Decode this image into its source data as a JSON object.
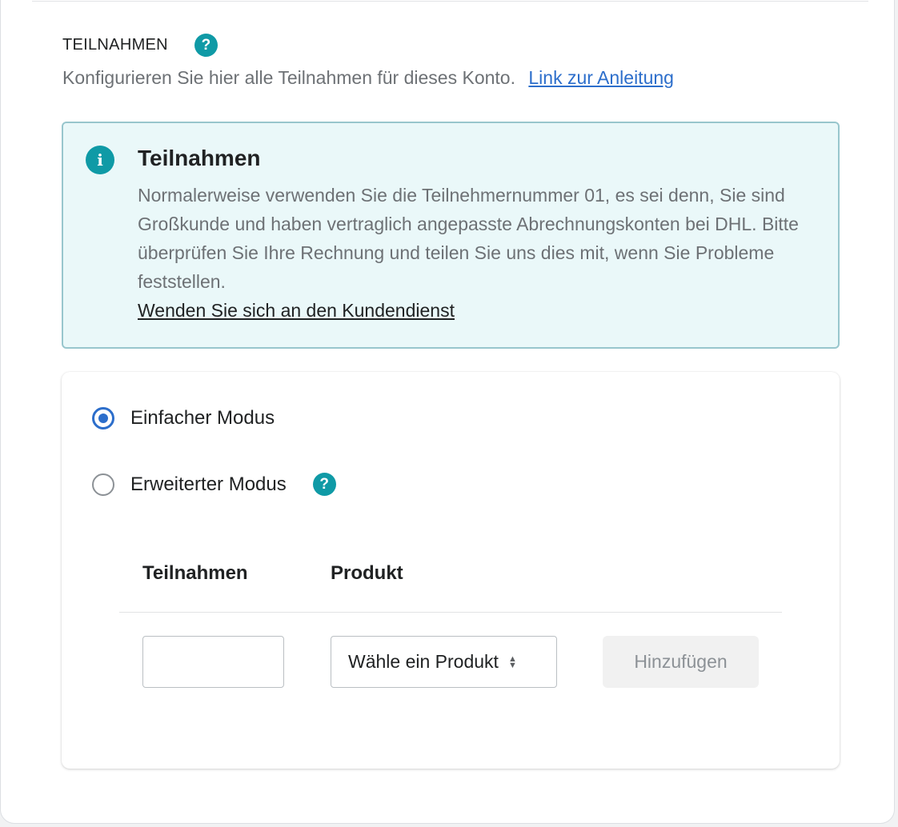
{
  "section": {
    "title": "TEILNAHMEN",
    "description": "Konfigurieren Sie hier alle Teilnahmen für dieses Konto.",
    "guide_link": "Link zur Anleitung"
  },
  "banner": {
    "title": "Teilnahmen",
    "body": "Normalerweise verwenden Sie die Teilnehmernummer 01, es sei denn, Sie sind Großkunde und haben vertraglich angepasste Abrechnungskonten bei DHL. Bitte überprüfen Sie Ihre Rechnung und teilen Sie uns dies mit, wenn Sie Probleme feststellen.",
    "support_link": "Wenden Sie sich an den Kundendienst"
  },
  "modes": {
    "simple": {
      "label": "Einfacher Modus",
      "checked": true
    },
    "advanced": {
      "label": "Erweiterter Modus",
      "checked": false
    }
  },
  "table": {
    "headers": [
      "Teilnahmen",
      "Produkt"
    ],
    "participation_value": "",
    "product_select": "Wähle ein Produkt",
    "add_button": "Hinzufügen"
  },
  "icons": {
    "help": "question-circle-icon",
    "info": "info-circle-icon",
    "select": "chevron-up-down-icon"
  },
  "colors": {
    "accent_teal": "#0f9aa6",
    "link_blue": "#2c6ecb",
    "banner_bg": "#eaf8f9",
    "banner_border": "#98c6cd"
  }
}
